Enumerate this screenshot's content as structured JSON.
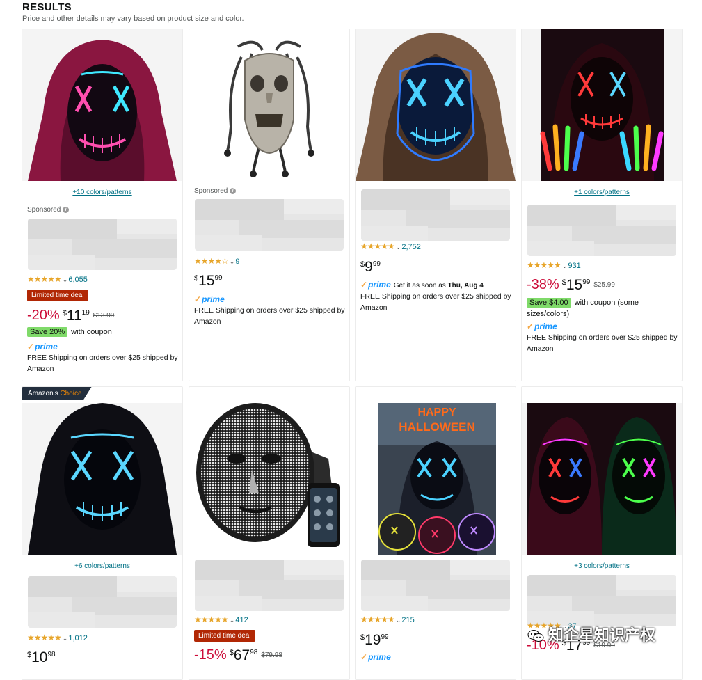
{
  "header": {
    "title": "RESULTS",
    "subtitle": "Price and other details may vary based on product size and color."
  },
  "products": [
    {
      "colors_link": "+10 colors/patterns",
      "sponsored": "Sponsored",
      "rating_stars": "★★★★★",
      "rating_count": "6,055",
      "deal_label": "Limited time deal",
      "discount": "-20%",
      "currency": "$",
      "price_whole": "11",
      "price_fraction": "19",
      "was_price": "$13.99",
      "coupon_tag": "Save 20%",
      "coupon_text": "with coupon",
      "prime_label": "prime",
      "shipping": "FREE Shipping on orders over $25 shipped by Amazon"
    },
    {
      "sponsored": "Sponsored",
      "rating_stars": "★★★★☆",
      "rating_count": "9",
      "currency": "$",
      "price_whole": "15",
      "price_fraction": "99",
      "prime_label": "prime",
      "shipping": "FREE Shipping on orders over $25 shipped by Amazon"
    },
    {
      "rating_stars": "★★★★★",
      "rating_count": "2,752",
      "currency": "$",
      "price_whole": "9",
      "price_fraction": "99",
      "prime_label": "prime",
      "delivery_prefix": "Get it as soon as",
      "delivery_date": "Thu, Aug 4",
      "shipping": "FREE Shipping on orders over $25 shipped by Amazon"
    },
    {
      "colors_link": "+1 colors/patterns",
      "rating_stars": "★★★★★",
      "rating_count": "931",
      "discount": "-38%",
      "currency": "$",
      "price_whole": "15",
      "price_fraction": "99",
      "was_price": "$25.99",
      "coupon_tag": "Save $4.00",
      "coupon_text": "with coupon (some sizes/colors)",
      "prime_label": "prime",
      "shipping": "FREE Shipping on orders over $25 shipped by Amazon"
    },
    {
      "badge_prefix": "Amazon's",
      "badge_choice": "Choice",
      "colors_link": "+6 colors/patterns",
      "rating_stars": "★★★★★",
      "rating_count": "1,012",
      "currency": "$",
      "price_whole": "10",
      "price_fraction": "98"
    },
    {
      "rating_stars": "★★★★★",
      "rating_count": "412",
      "deal_label": "Limited time deal",
      "discount": "-15%",
      "currency": "$",
      "price_whole": "67",
      "price_fraction": "98",
      "was_price": "$79.98"
    },
    {
      "rating_stars": "★★★★★",
      "rating_count": "215",
      "currency": "$",
      "price_whole": "19",
      "price_fraction": "99",
      "prime_label": "prime"
    },
    {
      "colors_link": "+3 colors/patterns",
      "rating_stars": "★★★★★",
      "rating_count": "37",
      "discount": "-10%",
      "currency": "$",
      "price_whole": "17",
      "price_fraction": "99",
      "was_price": "$19.99"
    }
  ],
  "watermark": "知企星知识产权",
  "icons": {
    "info": "info-icon",
    "prime_check": "prime-check-icon",
    "rating_chevron": "chevron-down-icon",
    "watermark": "wechat-icon"
  },
  "colors": {
    "link": "#007185",
    "deal": "#b12704",
    "discount": "#cc0c39",
    "coupon": "#7fda69",
    "prime": "#1a98ff",
    "star": "#e7a52a",
    "badge": "#232f3e"
  }
}
